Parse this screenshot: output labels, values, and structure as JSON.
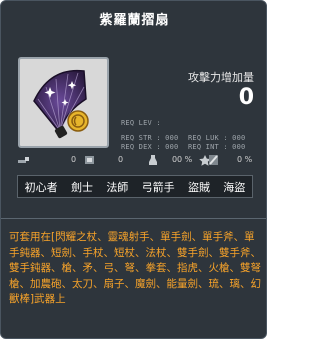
{
  "item": {
    "name": "紫羅蘭摺扇",
    "stat_label": "攻擊力增加量",
    "stat_value": "0"
  },
  "requirements": {
    "lev": "REQ LEV :",
    "str": "REQ STR :",
    "str_val": "000",
    "luk": "REQ LUK :",
    "luk_val": "000",
    "dex": "REQ DEX :",
    "dex_val": "000",
    "int": "REQ INT :",
    "int_val": "000"
  },
  "icon_stats": [
    {
      "icon": "sword-icon",
      "value": "0"
    },
    {
      "icon": "shield-icon",
      "value": "0"
    },
    {
      "icon": "potion-icon",
      "value": "0"
    },
    {
      "icon": "star-icon",
      "value": "0 %"
    },
    {
      "icon": "slash-icon",
      "value": "0 %"
    }
  ],
  "jobs": [
    "初心者",
    "劍士",
    "法師",
    "弓箭手",
    "盜賊",
    "海盜"
  ],
  "description": "可套用在[閃耀之杖、靈魂射手、單手劍、單手斧、單手鈍器、短劍、手杖、短杖、法杖、雙手劍、雙手斧、雙手鈍器、槍、矛、弓、弩、拳套、指虎、火槍、雙弩槍、加農砲、太刀、扇子、魔劍、能量劍、琉、璃、幻獸棒]武器上",
  "colors": {
    "background": "#2e353c",
    "description": "#f7a32a",
    "text": "#ffffff"
  }
}
